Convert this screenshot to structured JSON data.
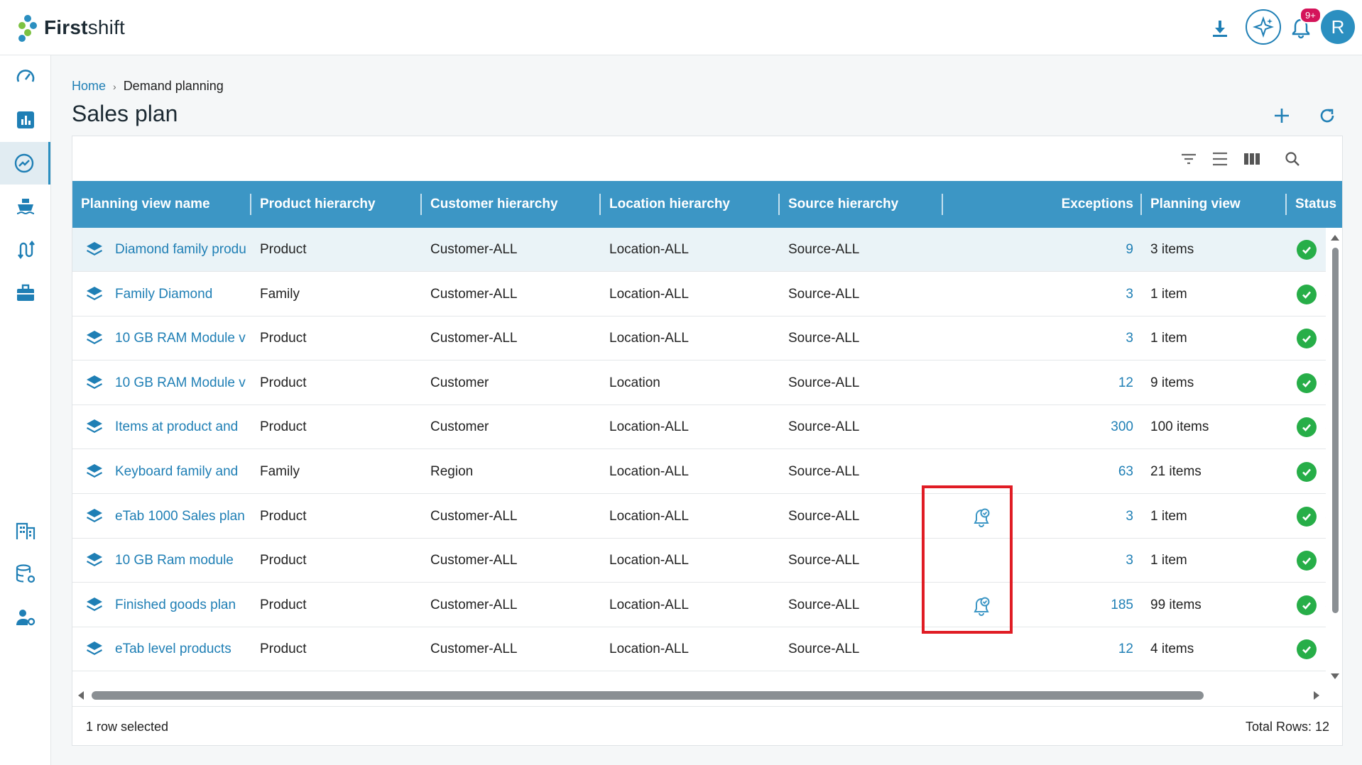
{
  "app": {
    "name_bold": "First",
    "name_rest": "shift",
    "notification_count": "9+",
    "avatar_initial": "R"
  },
  "sidebar": {
    "items": [
      {
        "icon": "speedometer-icon"
      },
      {
        "icon": "bar-chart-icon"
      },
      {
        "icon": "trending-chart-icon",
        "active": true
      },
      {
        "icon": "ship-icon"
      },
      {
        "icon": "route-icon"
      },
      {
        "icon": "briefcase-icon"
      },
      {
        "icon": "building-icon"
      },
      {
        "icon": "database-settings-icon"
      },
      {
        "icon": "user-settings-icon"
      }
    ]
  },
  "breadcrumb": {
    "home": "Home",
    "separator": "›",
    "current": "Demand planning"
  },
  "page": {
    "title": "Sales plan"
  },
  "table": {
    "columns": [
      "Planning view name",
      "Product hierarchy",
      "Customer hierarchy",
      "Location hierarchy",
      "Source hierarchy",
      "",
      "Exceptions",
      "Planning view",
      "Status"
    ],
    "rows": [
      {
        "name": "Diamond family produ",
        "product": "Product",
        "customer": "Customer-ALL",
        "location": "Location-ALL",
        "source": "Source-ALL",
        "alert": false,
        "exceptions": "9",
        "planning_view": "3 items",
        "status": "Success",
        "selected": true
      },
      {
        "name": "Family Diamond",
        "product": "Family",
        "customer": "Customer-ALL",
        "location": "Location-ALL",
        "source": "Source-ALL",
        "alert": false,
        "exceptions": "3",
        "planning_view": "1 item",
        "status": "Success"
      },
      {
        "name": "10 GB RAM Module v",
        "product": "Product",
        "customer": "Customer-ALL",
        "location": "Location-ALL",
        "source": "Source-ALL",
        "alert": false,
        "exceptions": "3",
        "planning_view": "1 item",
        "status": "Success"
      },
      {
        "name": "10 GB RAM Module v",
        "product": "Product",
        "customer": "Customer",
        "location": "Location",
        "source": "Source-ALL",
        "alert": false,
        "exceptions": "12",
        "planning_view": "9 items",
        "status": "Success"
      },
      {
        "name": "Items at product and",
        "product": "Product",
        "customer": "Customer",
        "location": "Location-ALL",
        "source": "Source-ALL",
        "alert": false,
        "exceptions": "300",
        "planning_view": "100 items",
        "status": "Success"
      },
      {
        "name": "Keyboard family and",
        "product": "Family",
        "customer": "Region",
        "location": "Location-ALL",
        "source": "Source-ALL",
        "alert": false,
        "exceptions": "63",
        "planning_view": "21 items",
        "status": "Success"
      },
      {
        "name": "eTab 1000 Sales plan",
        "product": "Product",
        "customer": "Customer-ALL",
        "location": "Location-ALL",
        "source": "Source-ALL",
        "alert": true,
        "exceptions": "3",
        "planning_view": "1 item",
        "status": "Success"
      },
      {
        "name": "10 GB Ram module",
        "product": "Product",
        "customer": "Customer-ALL",
        "location": "Location-ALL",
        "source": "Source-ALL",
        "alert": false,
        "exceptions": "3",
        "planning_view": "1 item",
        "status": "Success"
      },
      {
        "name": "Finished goods plan",
        "product": "Product",
        "customer": "Customer-ALL",
        "location": "Location-ALL",
        "source": "Source-ALL",
        "alert": true,
        "exceptions": "185",
        "planning_view": "99 items",
        "status": "Success"
      },
      {
        "name": "eTab level products",
        "product": "Product",
        "customer": "Customer-ALL",
        "location": "Location-ALL",
        "source": "Source-ALL",
        "alert": false,
        "exceptions": "12",
        "planning_view": "4 items",
        "status": "Success"
      }
    ]
  },
  "footer": {
    "selection": "1 row selected",
    "total": "Total Rows: 12"
  },
  "colors": {
    "accent": "#3c96c5",
    "link": "#1f7fb5",
    "success": "#27ae48",
    "highlight": "#e01c24"
  }
}
